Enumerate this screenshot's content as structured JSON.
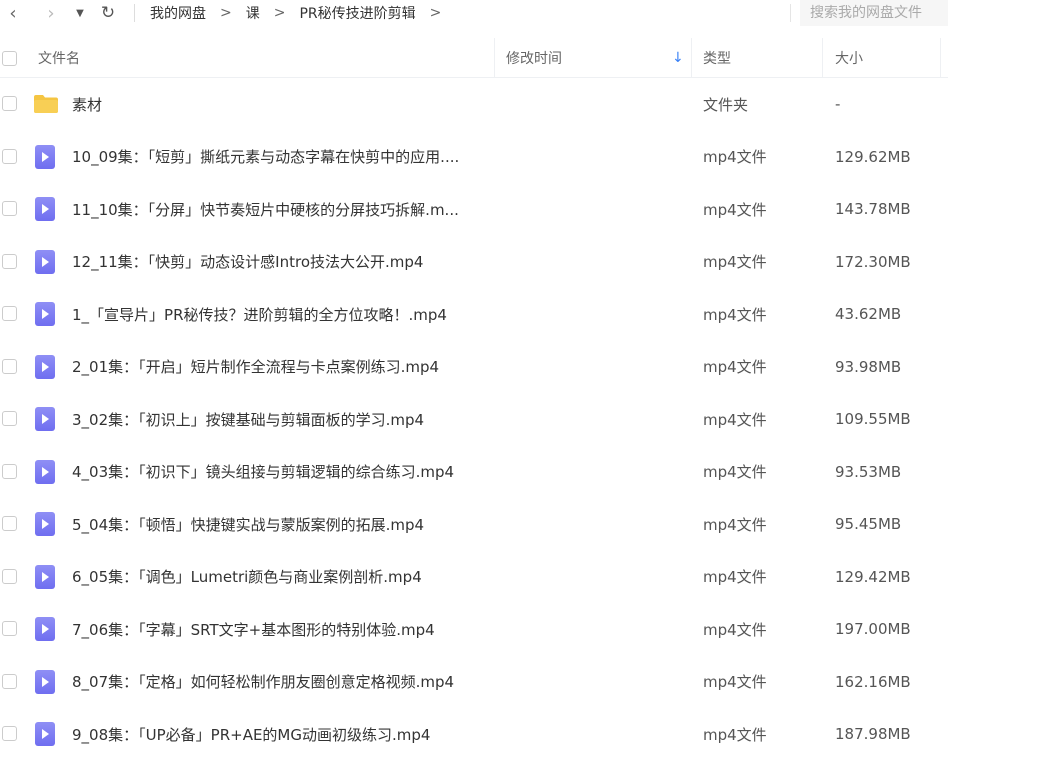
{
  "toolbar": {
    "back_glyph": "‹",
    "forward_glyph": "›",
    "history_glyph": "▼",
    "refresh_glyph": "↻",
    "breadcrumb": [
      "我的网盘",
      "课",
      "PR秘传技进阶剪辑"
    ],
    "crumb_sep": ">",
    "search_placeholder": "搜索我的网盘文件"
  },
  "header": {
    "name": "文件名",
    "modified": "修改时间",
    "sort_glyph": "↓",
    "type": "类型",
    "size": "大小"
  },
  "files": [
    {
      "name": "素材",
      "type": "文件夹",
      "size": "-",
      "icon": "folder-icon"
    },
    {
      "name": "10_09集：「短剪」撕纸元素与动态字幕在快剪中的应用....",
      "type": "mp4文件",
      "size": "129.62MB",
      "icon": "video-file-icon"
    },
    {
      "name": "11_10集：「分屏」快节奏短片中硬核的分屏技巧拆解.m...",
      "type": "mp4文件",
      "size": "143.78MB",
      "icon": "video-file-icon"
    },
    {
      "name": "12_11集：「快剪」动态设计感Intro技法大公开.mp4",
      "type": "mp4文件",
      "size": "172.30MB",
      "icon": "video-file-icon"
    },
    {
      "name": "1_「宣导片」PR秘传技？进阶剪辑的全方位攻略！.mp4",
      "type": "mp4文件",
      "size": "43.62MB",
      "icon": "video-file-icon"
    },
    {
      "name": "2_01集：「开启」短片制作全流程与卡点案例练习.mp4",
      "type": "mp4文件",
      "size": "93.98MB",
      "icon": "video-file-icon"
    },
    {
      "name": "3_02集：「初识上」按键基础与剪辑面板的学习.mp4",
      "type": "mp4文件",
      "size": "109.55MB",
      "icon": "video-file-icon"
    },
    {
      "name": "4_03集：「初识下」镜头组接与剪辑逻辑的综合练习.mp4",
      "type": "mp4文件",
      "size": "93.53MB",
      "icon": "video-file-icon"
    },
    {
      "name": "5_04集：「顿悟」快捷键实战与蒙版案例的拓展.mp4",
      "type": "mp4文件",
      "size": "95.45MB",
      "icon": "video-file-icon"
    },
    {
      "name": "6_05集：「调色」Lumetri颜色与商业案例剖析.mp4",
      "type": "mp4文件",
      "size": "129.42MB",
      "icon": "video-file-icon"
    },
    {
      "name": "7_06集：「字幕」SRT文字+基本图形的特别体验.mp4",
      "type": "mp4文件",
      "size": "197.00MB",
      "icon": "video-file-icon"
    },
    {
      "name": "8_07集：「定格」如何轻松制作朋友圈创意定格视频.mp4",
      "type": "mp4文件",
      "size": "162.16MB",
      "icon": "video-file-icon"
    },
    {
      "name": "9_08集：「UP必备」PR+AE的MG动画初级练习.mp4",
      "type": "mp4文件",
      "size": "187.98MB",
      "icon": "video-file-icon"
    }
  ],
  "colors": {
    "folder": "#f5c542",
    "video_icon": "#7b7af2",
    "sort_accent": "#3b82f6"
  }
}
